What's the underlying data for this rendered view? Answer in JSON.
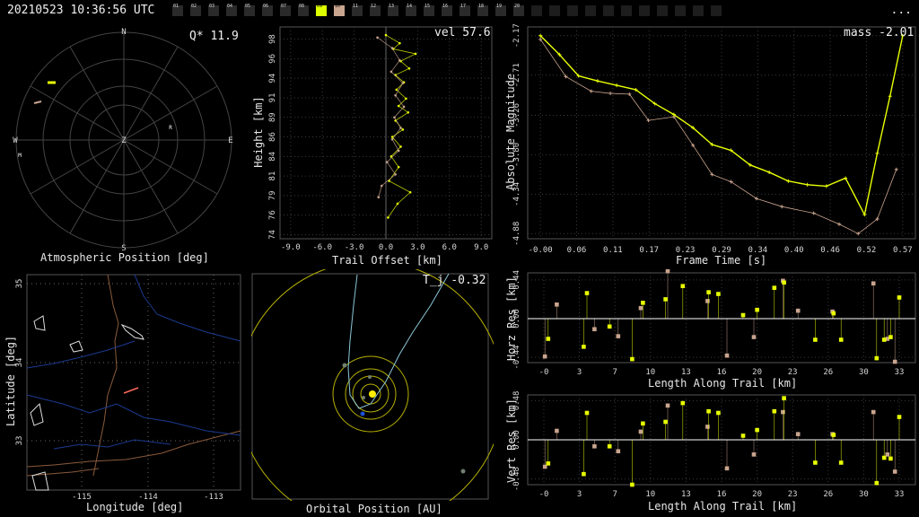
{
  "header": {
    "timestamp": "20210523 10:36:56 UTC",
    "menu_label": "...",
    "cameras": [
      {
        "label": "01",
        "state": "off"
      },
      {
        "label": "02",
        "state": "off"
      },
      {
        "label": "03",
        "state": "off"
      },
      {
        "label": "04",
        "state": "off"
      },
      {
        "label": "05",
        "state": "off"
      },
      {
        "label": "06",
        "state": "off"
      },
      {
        "label": "07",
        "state": "off"
      },
      {
        "label": "08",
        "state": "off"
      },
      {
        "label": "09",
        "state": "on"
      },
      {
        "label": "10",
        "state": "alt"
      },
      {
        "label": "11",
        "state": "off"
      },
      {
        "label": "12",
        "state": "off"
      },
      {
        "label": "13",
        "state": "off"
      },
      {
        "label": "14",
        "state": "off"
      },
      {
        "label": "15",
        "state": "off"
      },
      {
        "label": "16",
        "state": "off"
      },
      {
        "label": "17",
        "state": "off"
      },
      {
        "label": "18",
        "state": "off"
      },
      {
        "label": "19",
        "state": "off"
      },
      {
        "label": "20",
        "state": "off"
      },
      {
        "label": "",
        "state": "dark"
      },
      {
        "label": "",
        "state": "dark"
      },
      {
        "label": "",
        "state": "dark"
      },
      {
        "label": "",
        "state": "dark"
      },
      {
        "label": "",
        "state": "dark"
      },
      {
        "label": "",
        "state": "dark"
      },
      {
        "label": "",
        "state": "dark"
      },
      {
        "label": "",
        "state": "dark"
      },
      {
        "label": "",
        "state": "dark"
      },
      {
        "label": "",
        "state": "dark"
      },
      {
        "label": "",
        "state": "dark"
      }
    ]
  },
  "colors": {
    "primary": "#e8ff00",
    "secondary": "#c9a48e",
    "axis": "#d8d8d8",
    "grid": "#3a3a3a",
    "blue": "#1f4fd8"
  },
  "atmos": {
    "label": "Atmospheric Position [deg]",
    "q_label": "Q* 11.9",
    "directions": {
      "n": "N",
      "s": "S",
      "e": "E",
      "w": "W",
      "z": "Z"
    },
    "station_markers": [
      "R",
      "M"
    ]
  },
  "trail": {
    "label": "Trail Offset [km]",
    "ylabel": "Height [km]",
    "vel_label": "vel 57.6",
    "x_ticks": [
      "-9.0",
      "-6.0",
      "-3.0",
      "0.0",
      "3.0",
      "6.0",
      "9.0"
    ],
    "y_ticks": [
      "74",
      "76",
      "79",
      "81",
      "84",
      "86",
      "89",
      "91",
      "94",
      "96",
      "98"
    ]
  },
  "mag": {
    "xlabel": "Frame Time [s]",
    "ylabel": "Absolute Magnitude",
    "mass_label": "mass -2.01",
    "x_ticks": [
      "-0.00",
      "0.06",
      "0.11",
      "0.17",
      "0.23",
      "0.29",
      "0.34",
      "0.40",
      "0.46",
      "0.52",
      "0.57"
    ],
    "y_ticks": [
      "-4.88",
      "-4.34",
      "-3.80",
      "-3.26",
      "-2.71",
      "-2.17"
    ]
  },
  "map": {
    "xlabel": "Longitude [deg]",
    "ylabel": "Latitude [deg]",
    "x_ticks": [
      "-115",
      "-114",
      "-113"
    ],
    "y_ticks": [
      "35",
      "34",
      "33"
    ]
  },
  "orbit": {
    "label": "Orbital Position [AU]",
    "tj_label": "T_j -0.32"
  },
  "horz": {
    "xlabel": "Length Along Trail [km]",
    "ylabel": "Horz Res [km]",
    "x_ticks": [
      "-0",
      "3",
      "7",
      "10",
      "13",
      "16",
      "20",
      "23",
      "26",
      "30",
      "33"
    ],
    "y_ticks": [
      "0.44",
      "0.00",
      "-0.44"
    ]
  },
  "vert": {
    "xlabel": "Length Along Trail [km]",
    "ylabel": "Vert Res [km]",
    "x_ticks": [
      "-0",
      "3",
      "7",
      "10",
      "13",
      "16",
      "20",
      "23",
      "26",
      "30",
      "33"
    ],
    "y_ticks": [
      "0.48",
      "0.00",
      "-0.48"
    ]
  },
  "chart_data": [
    {
      "type": "line",
      "title": "",
      "xlabel": "Trail Offset [km]",
      "ylabel": "Height [km]",
      "xlim": [
        -10,
        10
      ],
      "ylim": [
        73.5,
        99.5
      ],
      "series": [
        {
          "name": "",
          "color": "primary",
          "x": [
            0.0,
            1.3,
            0.7,
            2.8,
            1.4,
            2.2,
            0.9,
            1.7,
            1.0,
            1.9,
            1.2,
            2.1,
            0.9,
            1.6,
            0.6,
            1.4,
            0.5,
            1.2,
            0.3,
            2.3,
            1.1,
            0.2
          ],
          "y": [
            98.5,
            97.5,
            96.8,
            96.2,
            95.3,
            94.4,
            93.6,
            92.7,
            91.8,
            90.7,
            89.8,
            89.0,
            88.0,
            86.9,
            86.0,
            84.8,
            83.6,
            82.3,
            80.6,
            79.2,
            77.8,
            76.1
          ]
        },
        {
          "name": "",
          "color": "secondary",
          "x": [
            -0.8,
            0.6,
            1.3,
            0.5,
            1.6,
            0.9,
            1.7,
            0.8,
            1.4,
            0.6,
            1.2,
            0.1,
            0.9,
            -0.4,
            -0.7
          ],
          "y": [
            98.2,
            96.9,
            95.4,
            94.0,
            92.6,
            91.1,
            89.7,
            88.4,
            87.1,
            85.7,
            84.3,
            82.9,
            81.4,
            80.0,
            78.6
          ]
        }
      ]
    },
    {
      "type": "line",
      "title": "",
      "xlabel": "Frame Time [s]",
      "ylabel": "Absolute Magnitude",
      "xlim": [
        -0.02,
        0.59
      ],
      "ylim": [
        -2.05,
        -4.95
      ],
      "series": [
        {
          "name": "",
          "color": "primary",
          "x": [
            0.0,
            0.03,
            0.06,
            0.09,
            0.12,
            0.15,
            0.18,
            0.21,
            0.24,
            0.27,
            0.3,
            0.33,
            0.36,
            0.39,
            0.42,
            0.45,
            0.48,
            0.51,
            0.53,
            0.55,
            0.57
          ],
          "y": [
            -2.17,
            -2.43,
            -2.72,
            -2.79,
            -2.85,
            -2.91,
            -3.1,
            -3.25,
            -3.43,
            -3.66,
            -3.74,
            -3.94,
            -4.04,
            -4.16,
            -4.21,
            -4.23,
            -4.12,
            -4.62,
            -3.78,
            -3.0,
            -2.17
          ]
        },
        {
          "name": "",
          "color": "secondary",
          "x": [
            0.0,
            0.04,
            0.08,
            0.11,
            0.14,
            0.17,
            0.21,
            0.24,
            0.27,
            0.3,
            0.34,
            0.38,
            0.43,
            0.47,
            0.5,
            0.53,
            0.56
          ],
          "y": [
            -2.22,
            -2.73,
            -2.93,
            -2.96,
            -2.97,
            -3.33,
            -3.28,
            -3.67,
            -4.07,
            -4.17,
            -4.4,
            -4.51,
            -4.6,
            -4.75,
            -4.88,
            -4.68,
            -4.0
          ]
        }
      ]
    },
    {
      "type": "scatter",
      "title": "",
      "xlabel": "Length Along Trail [km]",
      "ylabel": "Horz Res [km]",
      "xlim": [
        -1.5,
        34.5
      ],
      "ylim": [
        -0.5,
        0.52
      ],
      "series": [
        {
          "name": "",
          "color": "primary",
          "x": [
            0.4,
            3.7,
            4.0,
            6.1,
            8.2,
            9.2,
            11.3,
            12.9,
            15.3,
            16.2,
            18.5,
            19.8,
            21.4,
            22.3,
            25.2,
            26.9,
            27.6,
            30.9,
            31.6,
            32.2,
            33.0
          ],
          "y": [
            -0.23,
            -0.32,
            0.29,
            -0.09,
            -0.46,
            0.18,
            0.22,
            0.37,
            0.3,
            0.28,
            0.04,
            0.1,
            0.35,
            0.41,
            -0.24,
            0.06,
            -0.24,
            -0.45,
            -0.24,
            -0.21,
            0.24
          ]
        },
        {
          "name": "",
          "color": "secondary",
          "x": [
            0.1,
            1.2,
            4.7,
            6.9,
            9.0,
            11.5,
            15.2,
            17.0,
            19.5,
            22.2,
            23.6,
            26.8,
            30.6,
            31.9,
            32.6
          ],
          "y": [
            -0.43,
            0.16,
            -0.12,
            -0.2,
            0.12,
            0.54,
            0.2,
            -0.42,
            -0.21,
            0.43,
            0.09,
            0.08,
            0.4,
            -0.23,
            -0.49
          ]
        }
      ]
    },
    {
      "type": "scatter",
      "title": "",
      "xlabel": "Length Along Trail [km]",
      "ylabel": "Vert Res [km]",
      "xlim": [
        -1.5,
        34.5
      ],
      "ylim": [
        -0.55,
        0.55
      ],
      "series": [
        {
          "name": "",
          "color": "primary",
          "x": [
            0.4,
            3.7,
            4.0,
            6.1,
            8.2,
            9.2,
            11.3,
            12.9,
            15.3,
            16.2,
            18.5,
            19.8,
            21.4,
            22.3,
            25.2,
            26.9,
            27.6,
            30.9,
            31.6,
            32.2,
            33.0
          ],
          "y": [
            -0.29,
            -0.42,
            0.33,
            -0.08,
            -0.55,
            0.2,
            0.22,
            0.45,
            0.35,
            0.33,
            0.05,
            0.12,
            0.35,
            0.51,
            -0.28,
            0.06,
            -0.28,
            -0.53,
            -0.22,
            -0.23,
            0.28
          ]
        },
        {
          "name": "",
          "color": "secondary",
          "x": [
            0.1,
            1.2,
            4.7,
            6.9,
            9.0,
            11.5,
            15.2,
            17.0,
            19.5,
            22.2,
            23.6,
            26.8,
            30.6,
            31.9,
            32.6
          ],
          "y": [
            -0.33,
            0.11,
            -0.08,
            -0.14,
            0.1,
            0.42,
            0.16,
            -0.35,
            -0.18,
            0.34,
            0.07,
            0.07,
            0.34,
            -0.18,
            -0.39
          ]
        }
      ]
    }
  ]
}
